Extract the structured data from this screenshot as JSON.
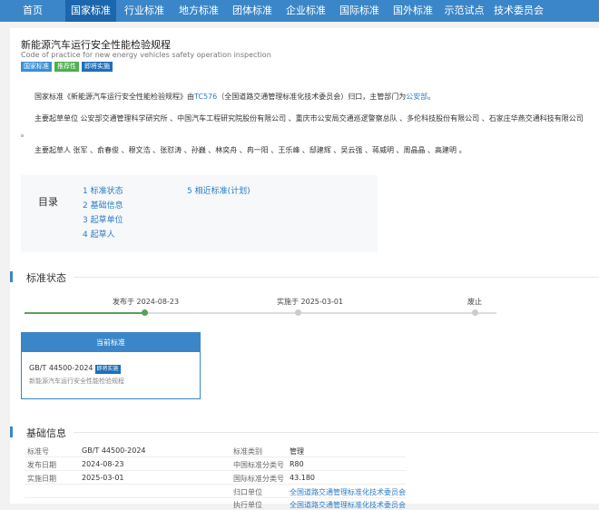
{
  "nav": {
    "items": [
      "首页",
      "国家标准",
      "行业标准",
      "地方标准",
      "团体标准",
      "企业标准",
      "国际标准",
      "国外标准",
      "示范试点",
      "技术委员会"
    ],
    "active_index": 1,
    "bg": "#3a86c8",
    "active_bg": "#1c66ad"
  },
  "standard": {
    "title": "新能源汽车运行安全性能检验规程",
    "subtitle": "Code of practice for new energy vehicles safety operation inspection",
    "badges": [
      "国家标准",
      "推荐性",
      "即将实施"
    ]
  },
  "intro": {
    "p1_prefix": "国家标准《新能源汽车运行安全性能检验规程》由",
    "p1_tc": "TC576",
    "p1_middle": "（全国道路交通管理标准化技术委员会）归口，主管部门为",
    "p1_dept": "公安部",
    "p1_suffix": "。",
    "p2": "主要起草单位 公安部交通管理科学研究所 、中国汽车工程研究院股份有限公司 、重庆市公安局交通巡逻警察总队 、多伦科技股份有限公司 、石家庄华燕交通科技有限公司",
    "p2_tail": "。",
    "p3": "主要起草人 张军 、俞春俊 、穆文浩 、张怼涛 、孙巍 、林奕舟 、冉一阳 、王乐峰 、邸建辉 、吴云强 、蒋威明 、周晶晶 、高建明 。"
  },
  "toc": {
    "label": "目录",
    "items": [
      "1 标准状态",
      "2 基础信息",
      "3 起草单位",
      "4 起草人",
      "5 相近标准(计划)"
    ]
  },
  "status_section": {
    "title": "标准状态",
    "timeline": [
      "发布于 2024-08-23",
      "实施于 2025-03-01",
      "废止"
    ],
    "card": {
      "head": "当前标准",
      "code": "GB/T 44500-2024",
      "badge": "即将实施",
      "name": "新能源汽车运行安全性能检验规程"
    }
  },
  "basic_section": {
    "title": "基础信息",
    "rows": [
      {
        "l1": "标准号",
        "v1": "GB/T 44500-2024",
        "l2": "标准类别",
        "v2": "管理"
      },
      {
        "l1": "发布日期",
        "v1": "2024-08-23",
        "l2": "中国标准分类号",
        "v2": "R80"
      },
      {
        "l1": "实施日期",
        "v1": "2025-03-01",
        "l2": "国际标准分类号",
        "v2": "43.180"
      },
      {
        "l1": "",
        "v1": "",
        "l2": "归口单位",
        "v2": "全国道路交通管理标准化技术委员会"
      },
      {
        "l1": "",
        "v1": "",
        "l2": "执行单位",
        "v2": "全国道路交通管理标准化技术委员会"
      }
    ]
  }
}
